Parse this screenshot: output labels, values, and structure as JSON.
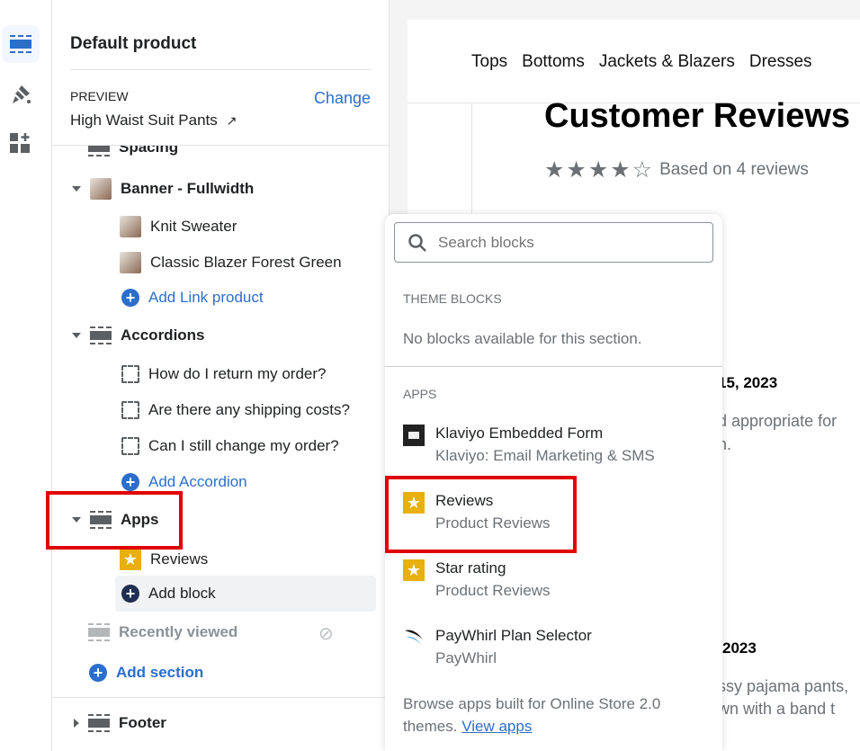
{
  "rail": {
    "icons": [
      "sections-icon",
      "theme-settings-icon",
      "app-embeds-icon"
    ]
  },
  "sidebar": {
    "title": "Default product",
    "preview_label": "PREVIEW",
    "change_label": "Change",
    "preview_product": "High Waist Suit Pants",
    "tree": {
      "spacing": "Spacing",
      "banner": "Banner - Fullwidth",
      "banner_items": [
        "Knit Sweater",
        "Classic Blazer Forest Green"
      ],
      "add_link_product": "Add Link product",
      "accordions": "Accordions",
      "accordion_items": [
        "How do I return my order?",
        "Are there any shipping costs?",
        "Can I still change my order?"
      ],
      "add_accordion": "Add Accordion",
      "apps": "Apps",
      "apps_items": [
        "Reviews"
      ],
      "add_block": "Add block",
      "recently_viewed": "Recently viewed",
      "add_section": "Add section",
      "footer": "Footer"
    }
  },
  "preview": {
    "nav": [
      "Tops",
      "Bottoms",
      "Jackets & Blazers",
      "Dresses"
    ],
    "heading": "Customer Reviews",
    "rating": 4.5,
    "based_on": "Based on 4 reviews",
    "date1": "15, 2023",
    "text1a": "d appropriate for",
    "text1b": "n.",
    "date2": "2023",
    "text2a": "ssy pajama pants,",
    "text2b": "wn with a band t"
  },
  "popover": {
    "search_placeholder": "Search blocks",
    "theme_blocks_label": "THEME BLOCKS",
    "no_blocks": "No blocks available for this section.",
    "apps_label": "APPS",
    "apps": [
      {
        "title": "Klaviyo Embedded Form",
        "sub": "Klaviyo: Email Marketing & SMS",
        "icon": "klaviyo-icon"
      },
      {
        "title": "Reviews",
        "sub": "Product Reviews",
        "icon": "star-icon"
      },
      {
        "title": "Star rating",
        "sub": "Product Reviews",
        "icon": "star-icon"
      },
      {
        "title": "PayWhirl Plan Selector",
        "sub": "PayWhirl",
        "icon": "paywhirl-icon"
      }
    ],
    "footer_text": "Browse apps built for Online Store 2.0 themes.",
    "view_apps": "View apps"
  },
  "colors": {
    "accent": "#2c6ecb",
    "highlight": "#e00000",
    "star": "#e7b00f"
  }
}
